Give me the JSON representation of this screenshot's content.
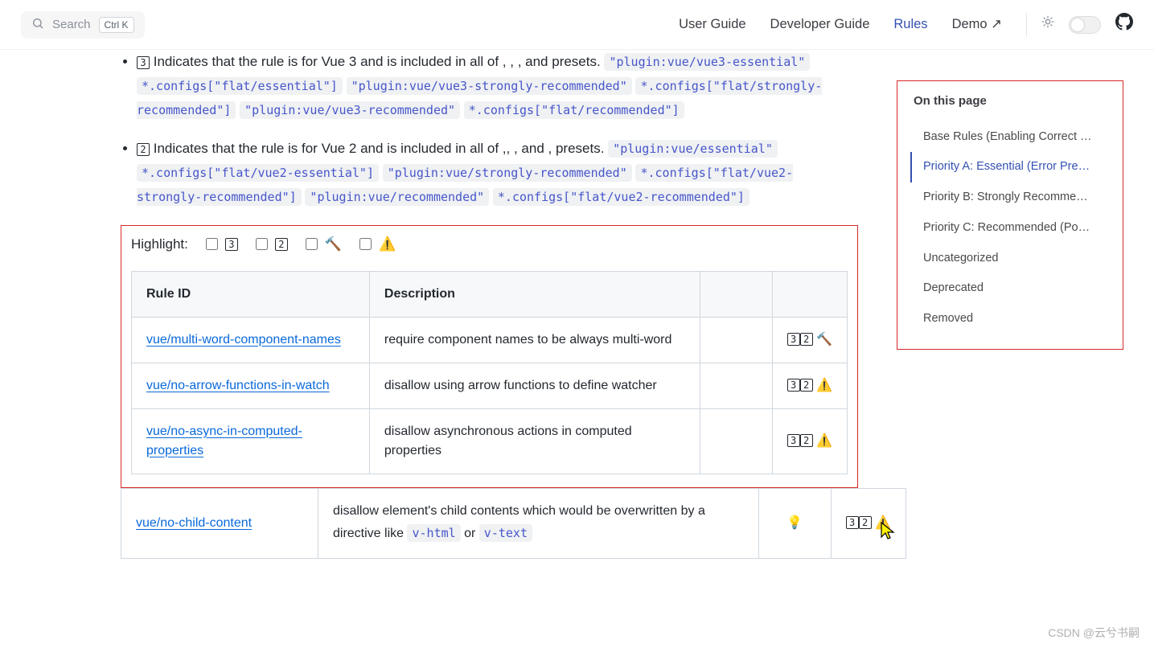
{
  "topbar": {
    "search_label": "Search",
    "search_kbd": "Ctrl K",
    "links": {
      "user_guide": "User Guide",
      "dev_guide": "Developer Guide",
      "rules": "Rules",
      "demo": "Demo ↗"
    }
  },
  "content": {
    "vue3_bullet_text_before": "Indicates that the rule is for Vue 3 and is included in all of , , , and presets.",
    "vue3_bullet_num": "3",
    "vue3_codes": [
      "\"plugin:vue/vue3-essential\"",
      "*.configs[\"flat/essential\"]",
      "\"plugin:vue/vue3-strongly-recommended\"",
      "*.configs[\"flat/strongly-recommended\"]",
      "\"plugin:vue/vue3-recommended\"",
      "*.configs[\"flat/recommended\"]"
    ],
    "vue2_bullet_num": "2",
    "vue2_bullet_text": "Indicates that the rule is for Vue 2 and is included in all of ,, , and , presets.",
    "vue2_codes": [
      "\"plugin:vue/essential\"",
      "*.configs[\"flat/vue2-essential\"]",
      "\"plugin:vue/strongly-recommended\"",
      "*.configs[\"flat/vue2-strongly-recommended\"]",
      "\"plugin:vue/recommended\"",
      "*.configs[\"flat/vue2-recommended\"]"
    ],
    "highlight_label": "Highlight:",
    "hl_option_3": "3",
    "hl_option_2": "2",
    "hl_option_hammer": "🔨",
    "hl_option_warn": "⚠️",
    "table": {
      "headers": {
        "rule_id": "Rule ID",
        "description": "Description"
      },
      "rows": [
        {
          "id": "vue/multi-word-component-names",
          "desc": "require component names to be always multi-word",
          "col3": "",
          "icons": "3️⃣2️⃣🔨"
        },
        {
          "id": "vue/no-arrow-functions-in-watch",
          "desc": "disallow using arrow functions to define watcher",
          "col3": "",
          "icons": "3️⃣2️⃣⚠️"
        },
        {
          "id": "vue/no-async-in-computed-properties",
          "desc": "disallow asynchronous actions in computed properties",
          "col3": "",
          "icons": "3️⃣2️⃣⚠️"
        },
        {
          "id": "vue/no-child-content",
          "desc_before": "disallow element's child contents which would be overwritten by a directive like ",
          "code1": "v-html",
          "desc_mid": " or ",
          "code2": "v-text",
          "col3": "💡",
          "icons": "3️⃣2️⃣⚠️"
        }
      ]
    }
  },
  "outline": {
    "title": "On this page",
    "items": [
      "Base Rules (Enabling Correct …",
      "Priority A: Essential (Error Pre…",
      "Priority B: Strongly Recomme…",
      "Priority C: Recommended (Po…",
      "Uncategorized",
      "Deprecated",
      "Removed"
    ],
    "active_index": 1
  },
  "watermark": "CSDN @云兮书嗣"
}
